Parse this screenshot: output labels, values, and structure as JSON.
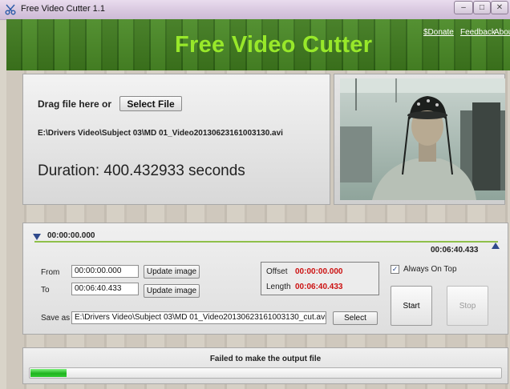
{
  "window": {
    "title": "Free Video Cutter 1.1",
    "minimize_label": "–",
    "maximize_label": "□",
    "close_label": "✕"
  },
  "header": {
    "title": "Free Video Cutter",
    "links": {
      "donate": "$Donate",
      "feedback": "Feedback",
      "about": "About"
    },
    "title_color": "#98e82a",
    "background_color": "#3f7a1e"
  },
  "file": {
    "drag_label": "Drag file here or",
    "select_button": "Select File",
    "path": "E:\\Drivers Video\\Subject 03\\MD 01_Video20130623161003130.avi",
    "duration": "Duration: 400.432933 seconds"
  },
  "preview": {
    "image": "video-frame-person-wearing-eeg-cap"
  },
  "timeline": {
    "start_time": "00:00:00.000",
    "end_time": "00:06:40.433",
    "from_label": "From",
    "from_value": "00:00:00.000",
    "to_label": "To",
    "to_value": "00:06:40.433",
    "update_button": "Update image",
    "offset_label": "Offset",
    "offset_value": "00:00:00.000",
    "length_label": "Length",
    "length_value": "00:06:40.433",
    "always_on_top_label": "Always On Top",
    "always_on_top_checked": true,
    "start_button": "Start",
    "stop_button": "Stop",
    "save_as_label": "Save as",
    "save_as_value": "E:\\Drivers Video\\Subject 03\\MD 01_Video20130623161003130_cut.avi",
    "select_button": "Select"
  },
  "status": {
    "message": "Failed to make the output file",
    "progress_fraction": 0.08,
    "progress_color": "#20b420"
  }
}
